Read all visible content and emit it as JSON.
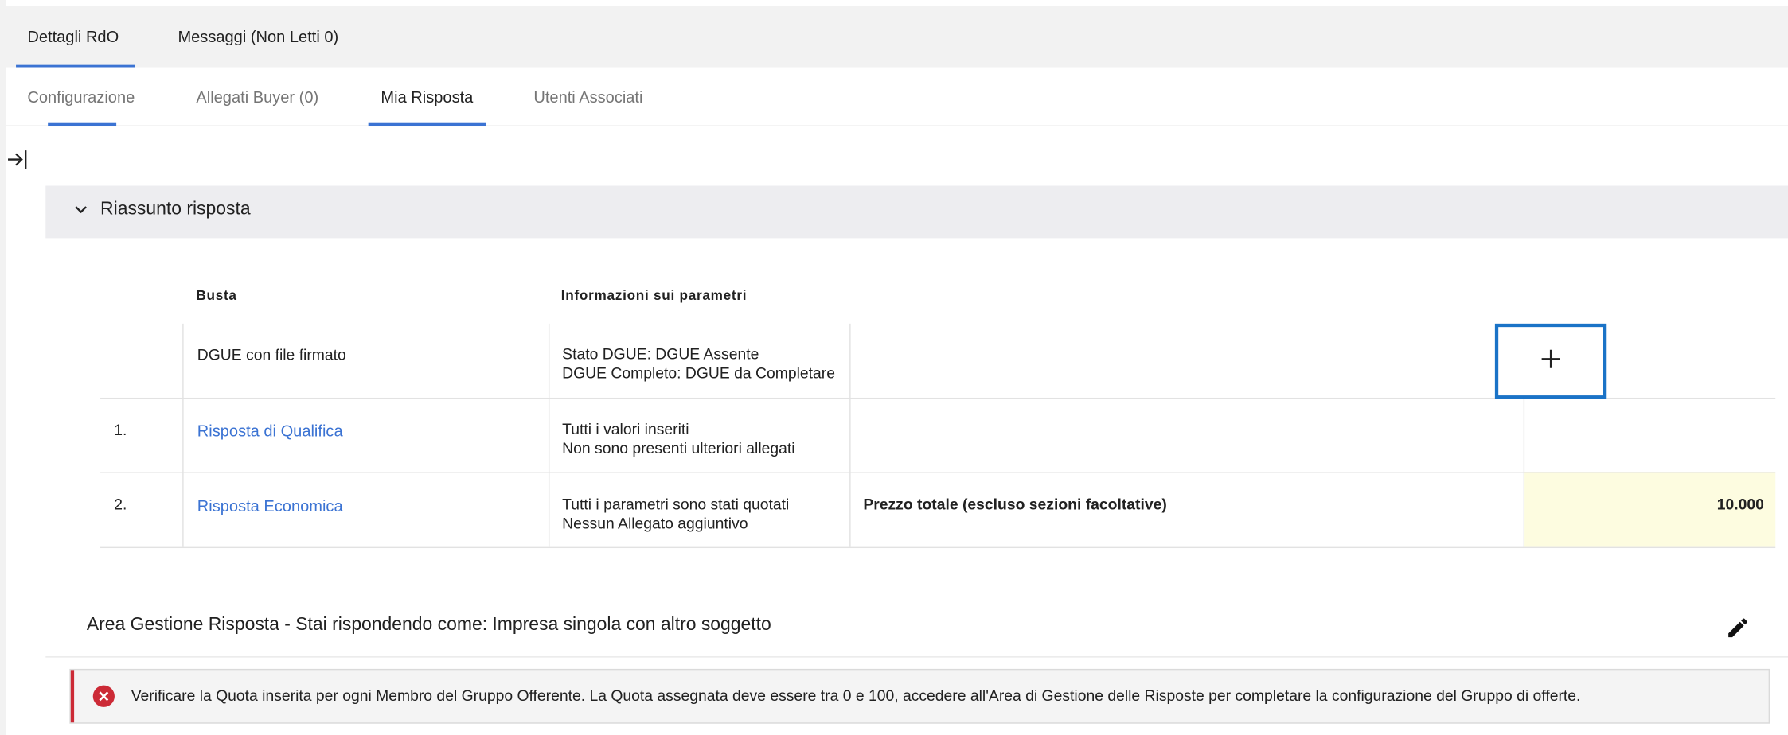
{
  "top_tabs": [
    {
      "label": "Dettagli RdO",
      "active": true
    },
    {
      "label": "Messaggi (Non Letti 0)",
      "active": false
    }
  ],
  "sub_tabs": [
    {
      "label": "Configurazione",
      "active": false
    },
    {
      "label": "Allegati Buyer (0)",
      "active": false
    },
    {
      "label": "Mia Risposta",
      "active": true
    },
    {
      "label": "Utenti Associati",
      "active": false
    }
  ],
  "icons": {
    "collapse_panel": "arrow-right-to-bar-icon",
    "accordion": "chevron-down-icon",
    "add": "plus-icon",
    "edit": "pencil-icon",
    "error": "error-circle-x-icon"
  },
  "accordion": {
    "title": "Riassunto risposta"
  },
  "table": {
    "headers": {
      "busta": "Busta",
      "info": "Informazioni sui parametri"
    },
    "dgue_row": {
      "busta": "DGUE con file firmato",
      "info_line1": "Stato DGUE: DGUE Assente",
      "info_line2": "DGUE Completo: DGUE da Completare",
      "add_symbol": "+"
    },
    "rows": [
      {
        "index": "1.",
        "busta": "Risposta di Qualifica",
        "info_line1": "Tutti i valori inseriti",
        "info_line2": "Non sono presenti ulteriori allegati",
        "param": "",
        "value": ""
      },
      {
        "index": "2.",
        "busta": "Risposta Economica",
        "info_line1": "Tutti i parametri sono stati quotati",
        "info_line2": "Nessun Allegato aggiuntivo",
        "param": "Prezzo totale (escluso sezioni facoltative)",
        "value": "10.000"
      }
    ]
  },
  "area": {
    "title": "Area Gestione Risposta - Stai rispondendo come: Impresa singola con altro soggetto"
  },
  "error": {
    "message": "Verificare la Quota inserita per ogni Membro del Gruppo Offerente. La Quota assegnata deve essere tra 0 e 100, accedere all'Area di Gestione delle Risposte per completare la configurazione del Gruppo di offerte."
  },
  "colors": {
    "accent": "#3b73d3",
    "highlight_border": "#1a73c7",
    "price_background": "#fdfce0",
    "error": "#cc2a36",
    "accordion_background": "#ededf0"
  }
}
